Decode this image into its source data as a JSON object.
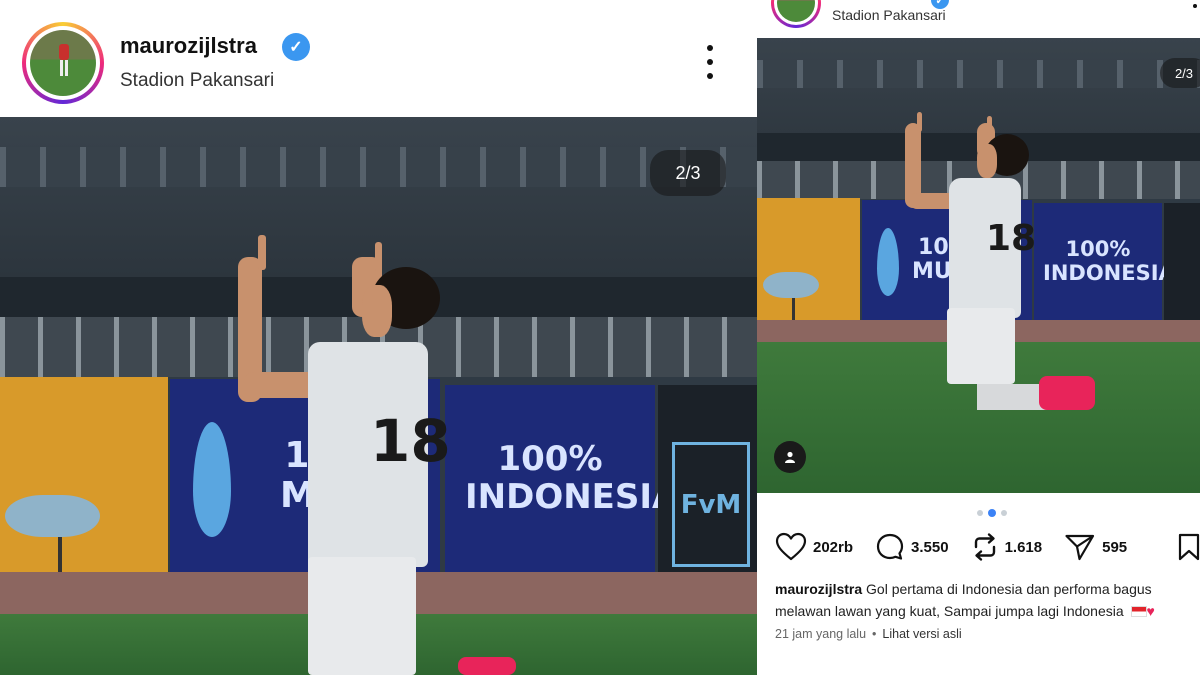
{
  "left_post": {
    "username": "maurozijlstra",
    "location": "Stadion Pakansari",
    "counter": "2/3",
    "photo": {
      "ad_text_1": "100% MURNI",
      "ad_text_2": "100% INDONESIA",
      "ad_logo": "FvM",
      "jersey_number": "18"
    }
  },
  "right_post": {
    "location": "Stadion Pakansari",
    "counter": "2/3",
    "photo": {
      "ad_text_1": "100% MURNI",
      "ad_text_2": "100% INDONESIA",
      "jersey_number": "18"
    },
    "carousel": {
      "total": 3,
      "active_index": 1
    },
    "actions": {
      "likes": "202rb",
      "comments": "3.550",
      "reposts": "1.618",
      "shares": "595"
    },
    "caption": {
      "username": "maurozijlstra",
      "text": "Gol pertama di Indonesia dan performa bagus melawan lawan yang kuat, Sampai jumpa lagi Indonesia"
    },
    "meta": {
      "time": "21 jam yang lalu",
      "separator": "•",
      "see_original": "Lihat versi asli"
    }
  },
  "icons": {
    "verified": "verified-badge-icon",
    "more": "more-options-icon",
    "like": "heart-icon",
    "comment": "comment-icon",
    "repost": "repost-icon",
    "share": "send-icon",
    "save": "bookmark-icon",
    "tagged": "person-tag-icon"
  },
  "colors": {
    "verified": "#3b97f0",
    "carousel_active": "#3b82f6",
    "ad_board": "#1d2a78",
    "boots": "#e8245a"
  }
}
